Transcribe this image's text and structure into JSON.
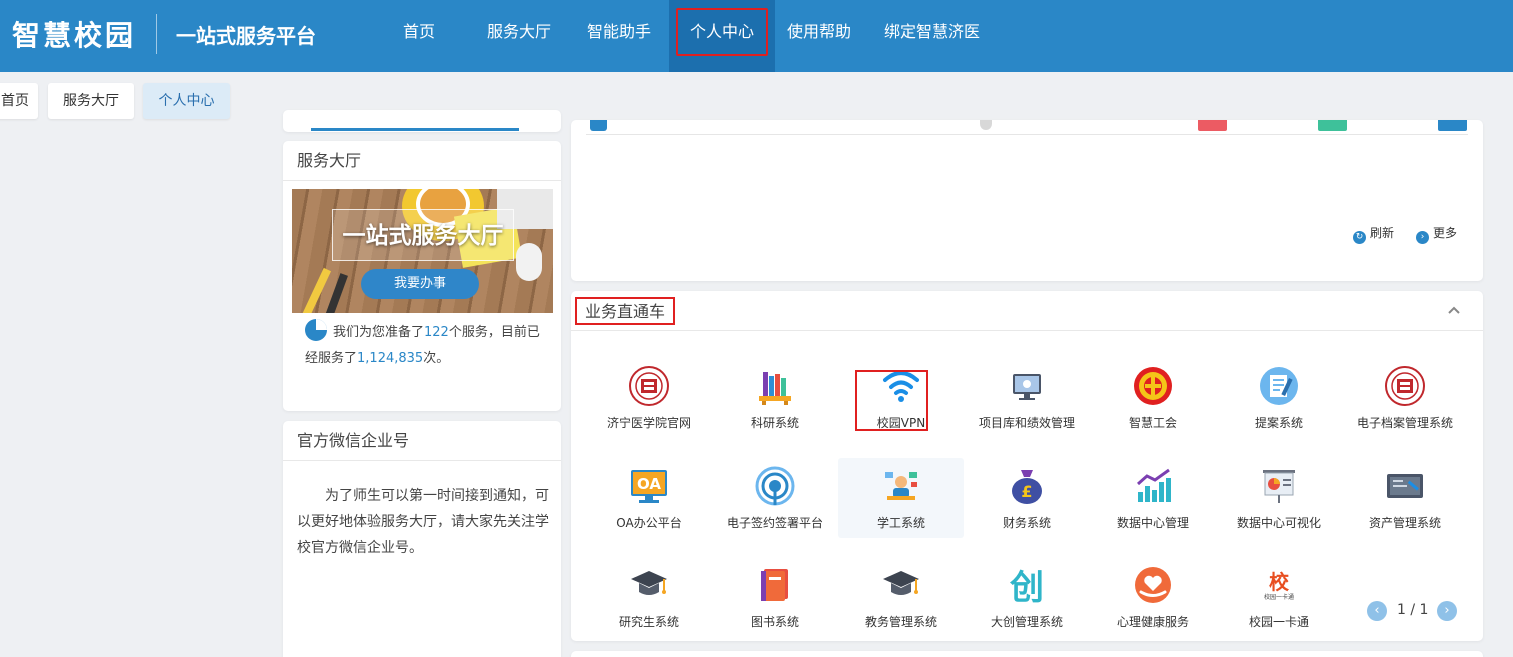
{
  "header": {
    "logo": "智慧校园",
    "platform": "一站式服务平台",
    "nav": [
      {
        "label": "首页"
      },
      {
        "label": "服务大厅"
      },
      {
        "label": "智能助手"
      },
      {
        "label": "个人中心",
        "active": true
      },
      {
        "label": "使用帮助"
      },
      {
        "label": "绑定智慧济医"
      }
    ]
  },
  "breadcrumbs": [
    "首页",
    "服务大厅",
    "个人中心"
  ],
  "service_hall": {
    "title": "服务大厅",
    "banner_text": "一站式服务大厅",
    "banner_button": "我要办事",
    "stat_prefix": "我们为您准备了",
    "service_count": "122",
    "stat_middle": "个服务，目前已经服务了",
    "served_count": "1,124,835",
    "stat_suffix": "次。"
  },
  "wechat": {
    "title": "官方微信企业号",
    "text": "为了师生可以第一时间接到通知，可以更好地体验服务大厅，请大家先关注学校官方微信企业号。"
  },
  "upper_card": {
    "refresh": "刷新",
    "more": "更多"
  },
  "business": {
    "title": "业务直通车",
    "apps": [
      {
        "label": "济宁医学院官网",
        "icon": "college-seal-icon"
      },
      {
        "label": "科研系统",
        "icon": "bookshelf-icon"
      },
      {
        "label": "校园VPN",
        "icon": "wifi-icon"
      },
      {
        "label": "项目库和绩效管理",
        "icon": "monitor-icon"
      },
      {
        "label": "智慧工会",
        "icon": "union-emblem-icon"
      },
      {
        "label": "提案系统",
        "icon": "document-pen-icon"
      },
      {
        "label": "电子档案管理系统",
        "icon": "college-seal-icon"
      },
      {
        "label": "OA办公平台",
        "icon": "oa-monitor-icon"
      },
      {
        "label": "电子签约签署平台",
        "icon": "signal-icon"
      },
      {
        "label": "学工系统",
        "icon": "student-work-icon"
      },
      {
        "label": "财务系统",
        "icon": "money-bag-icon"
      },
      {
        "label": "数据中心管理",
        "icon": "bar-chart-icon"
      },
      {
        "label": "数据中心可视化",
        "icon": "presentation-icon"
      },
      {
        "label": "资产管理系统",
        "icon": "device-icon"
      },
      {
        "label": "研究生系统",
        "icon": "graduation-cap-icon"
      },
      {
        "label": "图书系统",
        "icon": "book-icon"
      },
      {
        "label": "教务管理系统",
        "icon": "graduation-cap-icon"
      },
      {
        "label": "大创管理系统",
        "icon": "chuang-icon"
      },
      {
        "label": "心理健康服务",
        "icon": "heart-hand-icon"
      },
      {
        "label": "校园一卡通",
        "icon": "campus-card-icon"
      }
    ],
    "icon_glyphs": {
      "oa": "OA",
      "chuang": "创",
      "campus_card": "校",
      "campus_card_sub": "校园一卡通",
      "pound": "£"
    },
    "pager": "1 / 1"
  },
  "colors": {
    "header": "#2a87c7",
    "header_active": "#1c6fae",
    "highlight_box": "#e02020",
    "accent": "#2a87c7"
  }
}
